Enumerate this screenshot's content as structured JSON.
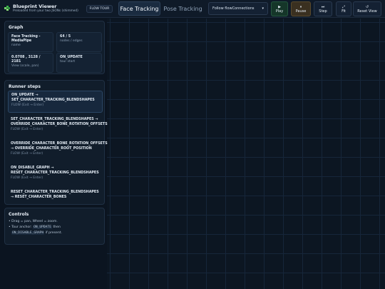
{
  "app": {
    "title": "Blueprint Viewer",
    "subtitle": "Preloaded from your two JSONs (shimmed)",
    "logo_icon": "puzzle-piece-icon"
  },
  "header": {
    "flow_tour_label": "FLOW TOUR",
    "tabs": [
      {
        "label": "Face Tracking",
        "active": true
      },
      {
        "label": "Pose Tracking",
        "active": false
      }
    ],
    "follow_select": {
      "value": "Follow flowConnections",
      "icon": "chevron-down-icon"
    },
    "buttons": {
      "play": {
        "glyph": "▶",
        "label": "Play"
      },
      "pause": {
        "glyph": "⏸",
        "label": "Pause"
      },
      "step": {
        "glyph": "⏭",
        "label": "Step"
      },
      "fit": {
        "glyph": "⤢",
        "label": "Fit"
      },
      "reset": {
        "glyph": "↺",
        "label": "Reset View"
      }
    }
  },
  "graph": {
    "title": "Graph",
    "stats": [
      {
        "value": "Face Tracking - MediaPipe",
        "key": "name"
      },
      {
        "value": "64 / 5",
        "key": "nodes / edges"
      },
      {
        "value": "0.0708 , 3128 / 2181",
        "key": "View (scale, pan)"
      },
      {
        "value": "ON_UPDATE",
        "key": "tour start"
      }
    ]
  },
  "runner": {
    "title": "Runner steps",
    "steps": [
      {
        "name": "ON_UPDATE → SET_CHARACTER_TRACKING_BLENDSHAPES",
        "meta": "FLOW (Exit → Enter)",
        "active": true
      },
      {
        "name": "SET_CHARACTER_TRACKING_BLENDSHAPES → OVERRIDE_CHARACTER_BONE_ROTATION_OFFSETS",
        "meta": "FLOW (Exit → Enter)",
        "active": false
      },
      {
        "name": "OVERRIDE_CHARACTER_BONE_ROTATION_OFFSETS → OVERRIDE_CHARACTER_ROOT_POSITION",
        "meta": "FLOW (Exit → Enter)",
        "active": false
      },
      {
        "name": "ON_DISABLE_GRAPH → RESET_CHARACTER_TRACKING_BLENDSHAPES",
        "meta": "FLOW (Exit → Enter)",
        "active": false
      },
      {
        "name": "RESET_CHARACTER_TRACKING_BLENDSHAPES → RESET_CHARACTER_BONES",
        "meta": "",
        "active": false
      }
    ]
  },
  "controls": {
    "title": "Controls",
    "line1": "• Drag = pan, Wheel = zoom.",
    "line2_prefix": "• Tour anchor:",
    "line2_code": "ON_UPDATE",
    "line2_suffix": "then",
    "line3_code": "ON_DISABLE_GRAPH",
    "line3_suffix": "if present."
  }
}
